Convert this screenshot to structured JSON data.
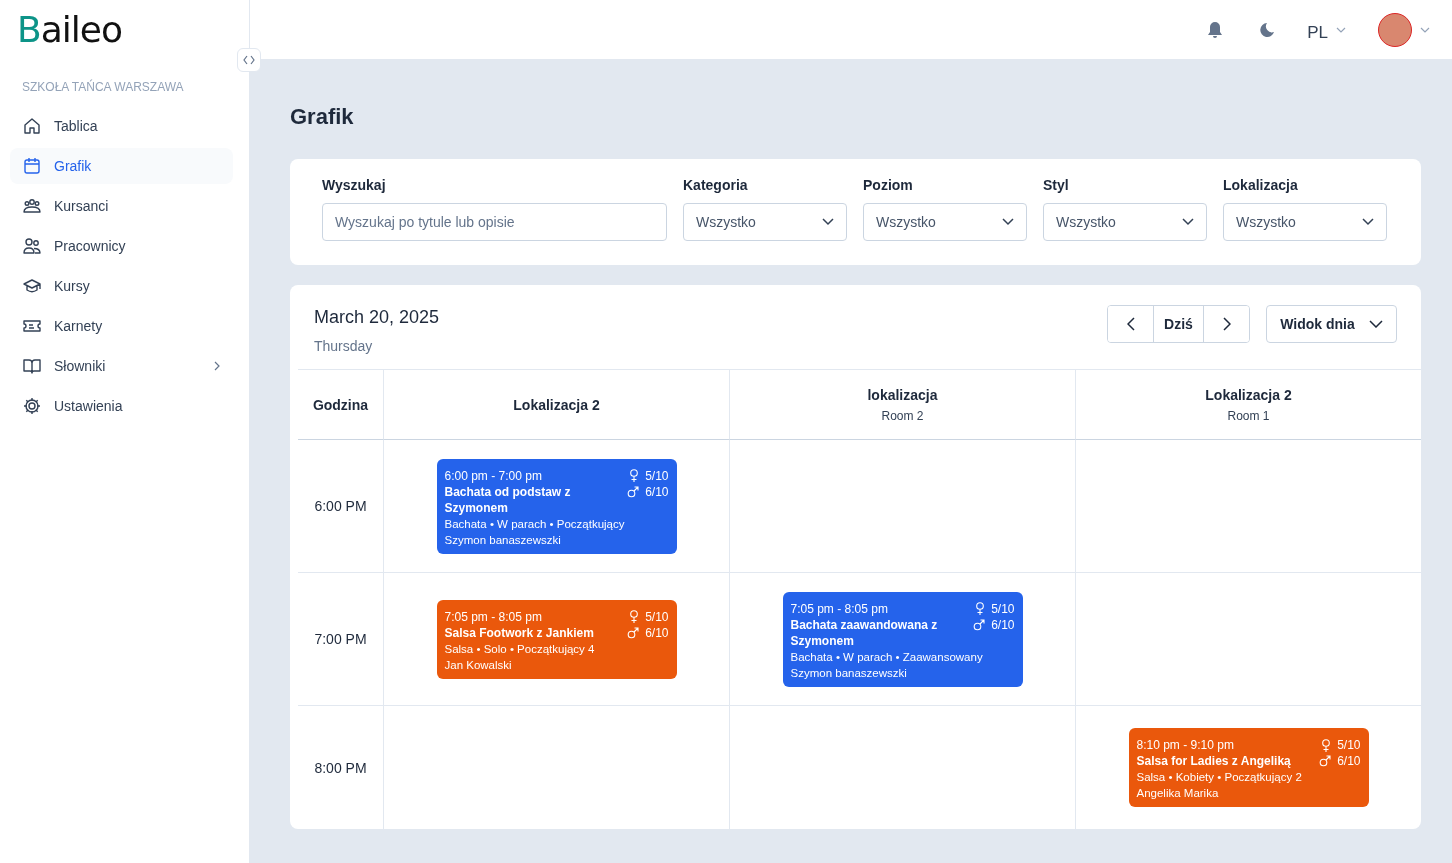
{
  "logo": "Baileo",
  "school": "SZKOŁA TAŃCA WARSZAWA",
  "nav": [
    {
      "label": "Tablica",
      "selected": false
    },
    {
      "label": "Grafik",
      "selected": true
    },
    {
      "label": "Kursanci",
      "selected": false
    },
    {
      "label": "Pracownicy",
      "selected": false
    },
    {
      "label": "Kursy",
      "selected": false
    },
    {
      "label": "Karnety",
      "selected": false
    },
    {
      "label": "Słowniki",
      "selected": false,
      "submenu": true
    },
    {
      "label": "Ustawienia",
      "selected": false
    }
  ],
  "topbar": {
    "language": "PL"
  },
  "page_title": "Grafik",
  "filters": {
    "search": {
      "label": "Wyszukaj",
      "placeholder": "Wyszukaj po tytule lub opisie"
    },
    "selects": [
      {
        "label": "Kategoria",
        "value": "Wszystko"
      },
      {
        "label": "Poziom",
        "value": "Wszystko"
      },
      {
        "label": "Styl",
        "value": "Wszystko"
      },
      {
        "label": "Lokalizacja",
        "value": "Wszystko"
      }
    ]
  },
  "calendar": {
    "date": "March 20, 2025",
    "weekday": "Thursday",
    "today_button": "Dziś",
    "view_button": "Widok dnia",
    "time_header": "Godzina",
    "columns": [
      {
        "title": "Lokalizacja 2"
      },
      {
        "title": "lokalizacja",
        "subtitle": "Room 2"
      },
      {
        "title": "Lokalizacja 2",
        "subtitle": "Room 1"
      }
    ],
    "rows": [
      {
        "time": "6:00 PM",
        "cells": [
          {
            "event": {
              "time": "6:00 pm - 7:00 pm",
              "title": "Bachata od podstaw z Szymonem",
              "female": "5/10",
              "male": "6/10",
              "details": "Bachata • W parach • Początkujący",
              "teacher": "Szymon banaszewszki",
              "color": "#2563eb"
            }
          },
          {},
          {}
        ]
      },
      {
        "time": "7:00 PM",
        "cells": [
          {
            "event": {
              "time": "7:05 pm - 8:05 pm",
              "title": "Salsa Footwork z Jankiem",
              "female": "5/10",
              "male": "6/10",
              "details": "Salsa • Solo • Początkujący 4",
              "teacher": "Jan Kowalski",
              "color": "#ea580c"
            }
          },
          {
            "event": {
              "time": "7:05 pm - 8:05 pm",
              "title": "Bachata zaawandowana z Szymonem",
              "female": "5/10",
              "male": "6/10",
              "details": "Bachata • W parach • Zaawansowany",
              "teacher": "Szymon banaszewszki",
              "color": "#2563eb"
            }
          },
          {}
        ]
      },
      {
        "time": "8:00 PM",
        "cells": [
          {},
          {},
          {
            "event": {
              "time": "8:10 pm - 9:10 pm",
              "title": "Salsa for Ladies z Angeliką",
              "female": "5/10",
              "male": "6/10",
              "details": "Salsa • Kobiety • Początkujący 2",
              "teacher": "Angelika Marika",
              "color": "#ea580c"
            }
          }
        ]
      }
    ]
  }
}
